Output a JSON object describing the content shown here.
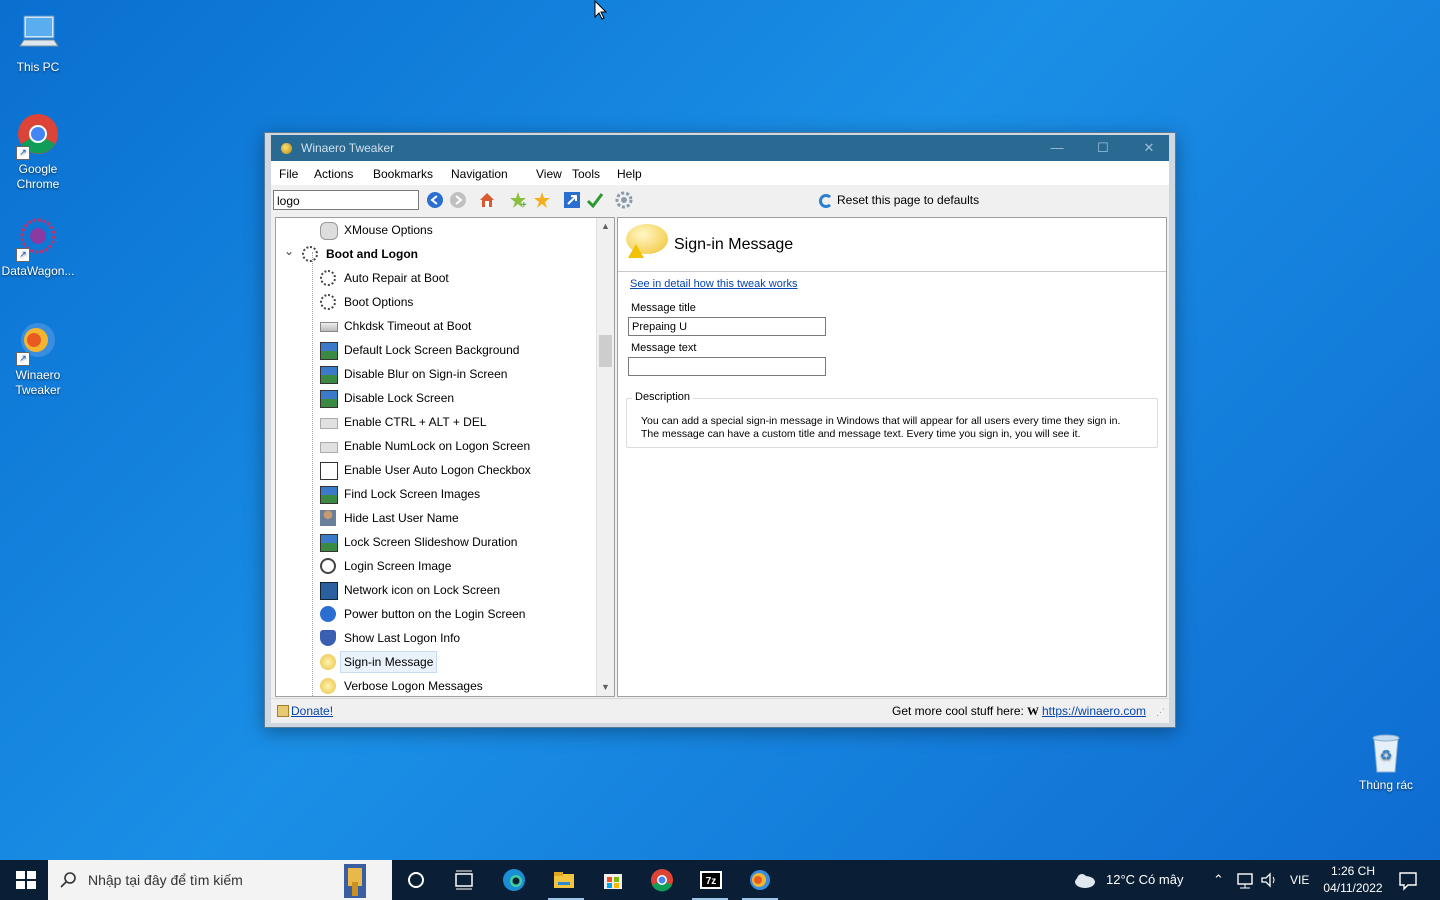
{
  "desktop": {
    "icons": [
      {
        "label": "This PC"
      },
      {
        "label": "Google Chrome"
      },
      {
        "label": "DataWagon..."
      },
      {
        "label": "Winaero Tweaker"
      }
    ],
    "recycle_label": "Thùng rác"
  },
  "window": {
    "title": "Winaero Tweaker",
    "controls": {
      "minimize": "—",
      "maximize": "☐",
      "close": "✕"
    },
    "menu": [
      "File",
      "Actions",
      "Bookmarks",
      "Navigation",
      "View",
      "Tools",
      "Help"
    ],
    "search_value": "logo",
    "reset_label": "Reset this page to defaults",
    "tree": {
      "items": [
        {
          "label": "XMouse Options",
          "level": 2,
          "icon": "mouse-icon"
        },
        {
          "label": "Boot and Logon",
          "level": 1,
          "icon": "spinner-icon",
          "bold": true
        },
        {
          "label": "Auto Repair at Boot",
          "level": 2,
          "icon": "spinner-icon"
        },
        {
          "label": "Boot Options",
          "level": 2,
          "icon": "spinner-icon"
        },
        {
          "label": "Chkdsk Timeout at Boot",
          "level": 2,
          "icon": "drive-icon"
        },
        {
          "label": "Default Lock Screen Background",
          "level": 2,
          "icon": "landscape-icon"
        },
        {
          "label": "Disable Blur on Sign-in Screen",
          "level": 2,
          "icon": "landscape-icon"
        },
        {
          "label": "Disable Lock Screen",
          "level": 2,
          "icon": "landscape-icon"
        },
        {
          "label": "Enable CTRL + ALT + DEL",
          "level": 2,
          "icon": "keyboard-icon"
        },
        {
          "label": "Enable NumLock on Logon Screen",
          "level": 2,
          "icon": "keyboard-icon"
        },
        {
          "label": "Enable User Auto Logon Checkbox",
          "level": 2,
          "icon": "checkbox-icon"
        },
        {
          "label": "Find Lock Screen Images",
          "level": 2,
          "icon": "landscape-icon"
        },
        {
          "label": "Hide Last User Name",
          "level": 2,
          "icon": "user-icon"
        },
        {
          "label": "Lock Screen Slideshow Duration",
          "level": 2,
          "icon": "landscape-icon"
        },
        {
          "label": "Login Screen Image",
          "level": 2,
          "icon": "user-circle-icon"
        },
        {
          "label": "Network icon on Lock Screen",
          "level": 2,
          "icon": "network-icon"
        },
        {
          "label": "Power button on the Login Screen",
          "level": 2,
          "icon": "power-icon"
        },
        {
          "label": "Show Last Logon Info",
          "level": 2,
          "icon": "shield-icon"
        },
        {
          "label": "Sign-in Message",
          "level": 2,
          "icon": "message-icon",
          "selected": true
        },
        {
          "label": "Verbose Logon Messages",
          "level": 2,
          "icon": "message-icon"
        }
      ]
    },
    "page": {
      "title": "Sign-in Message",
      "link": "See in detail how this tweak works",
      "message_title_label": "Message title",
      "message_title_value": "Prepaing U",
      "message_text_label": "Message text",
      "message_text_value": "",
      "description_label": "Description",
      "description_line1": "You can add a special sign-in message in Windows that will appear for all users every time they sign in.",
      "description_line2": "The message can have a custom title and message text. Every time you sign in, you will see it."
    },
    "status": {
      "donate": "Donate!",
      "more": "Get more cool stuff here:",
      "w": "W",
      "url": "https://winaero.com"
    }
  },
  "taskbar": {
    "search_placeholder": "Nhập tại đây để tìm kiếm",
    "weather": "12°C  Có mây",
    "lang": "VIE",
    "time": "1:26 CH",
    "date": "04/11/2022"
  },
  "colors": {
    "accent": "#2a6a92",
    "desktop": "#1a8fe6",
    "link": "#0645ad"
  }
}
